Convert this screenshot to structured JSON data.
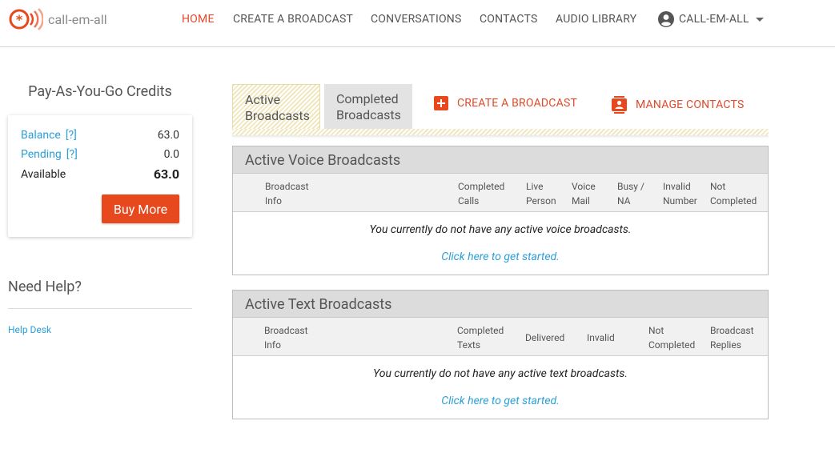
{
  "app": {
    "logo_text": "call-em-all"
  },
  "nav": {
    "items": [
      {
        "label": "HOME",
        "active": true
      },
      {
        "label": "CREATE A BROADCAST",
        "active": false
      },
      {
        "label": "CONVERSATIONS",
        "active": false
      },
      {
        "label": "CONTACTS",
        "active": false
      },
      {
        "label": "AUDIO LIBRARY",
        "active": false
      }
    ],
    "account_label": "CALL-EM-ALL"
  },
  "credits": {
    "title": "Pay-As-You-Go Credits",
    "balance_label": "Balance",
    "balance_help": "[?]",
    "balance_value": "63.0",
    "pending_label": "Pending",
    "pending_help": "[?]",
    "pending_value": "0.0",
    "available_label": "Available",
    "available_value": "63.0",
    "buy_label": "Buy More"
  },
  "help": {
    "title": "Need Help?",
    "link": "Help Desk"
  },
  "tabs": {
    "active": [
      "Active",
      "Broadcasts"
    ],
    "inactive": [
      "Completed",
      "Broadcasts"
    ],
    "create_label": "CREATE A BROADCAST",
    "manage_label": "MANAGE CONTACTS"
  },
  "voice": {
    "title": "Active Voice Broadcasts",
    "columns": [
      [
        "Broadcast",
        "Info"
      ],
      [
        "Completed",
        "Calls"
      ],
      [
        "Live",
        "Person"
      ],
      [
        "Voice",
        "Mail"
      ],
      [
        "Busy /",
        "NA"
      ],
      [
        "Invalid",
        "Number"
      ],
      [
        "Not",
        "Completed"
      ]
    ],
    "empty": "You currently do not have any active voice broadcasts.",
    "link": "Click here to get started."
  },
  "text": {
    "title": "Active Text Broadcasts",
    "columns": [
      [
        "Broadcast",
        "Info"
      ],
      [
        "Completed",
        "Texts"
      ],
      [
        "Delivered"
      ],
      [
        "Invalid"
      ],
      [
        "Not",
        "Completed"
      ],
      [
        "Broadcast",
        "Replies"
      ]
    ],
    "empty": "You currently do not have any active text broadcasts.",
    "link": "Click here to get started."
  },
  "colors": {
    "accent": "#e14a2a",
    "button": "#e8481d",
    "link": "#2a9fd8"
  }
}
